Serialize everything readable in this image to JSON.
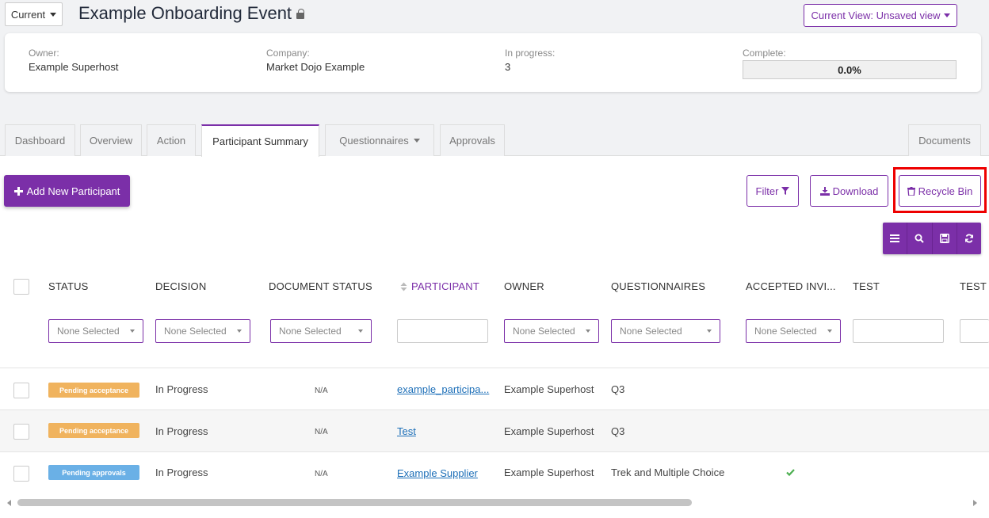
{
  "header": {
    "version_select": "Current",
    "event_title": "Example Onboarding Event",
    "view_button": "Current View: Unsaved view"
  },
  "info": {
    "owner_label": "Owner:",
    "owner_value": "Example Superhost",
    "company_label": "Company:",
    "company_value": "Market Dojo Example",
    "in_progress_label": "In progress:",
    "in_progress_value": "3",
    "complete_label": "Complete:",
    "complete_value": "0.0%"
  },
  "tabs": [
    "Dashboard",
    "Overview",
    "Action",
    "Participant Summary",
    "Questionnaires",
    "Approvals",
    "Documents"
  ],
  "actions": {
    "add_participant": "Add New Participant",
    "filter": "Filter",
    "download": "Download",
    "recycle_bin": "Recycle Bin"
  },
  "columns": [
    "STATUS",
    "DECISION",
    "DOCUMENT STATUS",
    "PARTICIPANT",
    "OWNER",
    "QUESTIONNAIRES",
    "ACCEPTED INVI...",
    "TEST",
    "TEST"
  ],
  "filters": {
    "placeholder": "None Selected"
  },
  "rows": [
    {
      "status": "Pending acceptance",
      "decision": "In Progress",
      "document_status": "N/A",
      "participant": "example_participa...",
      "owner": "Example Superhost",
      "questionnaires": "Q3",
      "accepted": ""
    },
    {
      "status": "Pending acceptance",
      "decision": "In Progress",
      "document_status": "N/A",
      "participant": "Test",
      "owner": "Example Superhost",
      "questionnaires": "Q3",
      "accepted": ""
    },
    {
      "status": "Pending approvals",
      "decision": "In Progress",
      "document_status": "N/A",
      "participant": "Example Supplier",
      "owner": "Example Superhost",
      "questionnaires": "Trek and Multiple Choice",
      "accepted": "check"
    }
  ],
  "colors": {
    "brand_purple": "#7b2fa8",
    "badge_acceptance": "#f0b35e",
    "badge_approvals": "#6ab0e6",
    "check_green": "#4caf50",
    "highlight_red": "#ee0000"
  }
}
